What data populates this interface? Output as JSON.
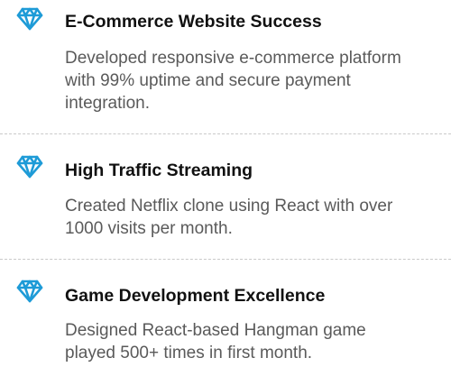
{
  "accent_color": "#1e9bd7",
  "achievements": [
    {
      "icon": "diamond-icon",
      "title": "E-Commerce Website Success",
      "description_lines": [
        "Developed responsive e-commerce platform",
        "with 99% uptime and secure payment",
        "integration."
      ]
    },
    {
      "icon": "diamond-icon",
      "title": "High Traffic Streaming",
      "description_lines": [
        "Created Netflix clone using React with over",
        "1000 visits per month."
      ]
    },
    {
      "icon": "diamond-icon",
      "title": "Game Development Excellence",
      "description_lines": [
        "Designed React-based Hangman game",
        "played 500+ times in first month."
      ]
    }
  ]
}
